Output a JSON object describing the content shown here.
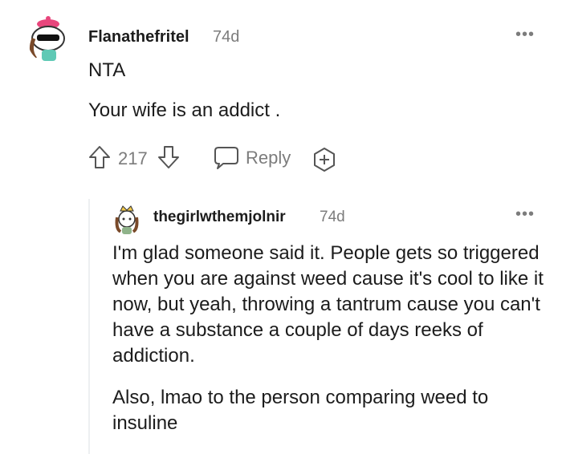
{
  "comment": {
    "username": "Flanathefritel",
    "age": "74d",
    "paragraphs": [
      "NTA",
      "Your wife is an addict ."
    ],
    "votes": "217",
    "reply_label": "Reply",
    "avatar_icon": "snoo-avatar-pink-hat-icon",
    "more_icon": "more-options-icon",
    "upvote_icon": "upvote-arrow-icon",
    "downvote_icon": "downvote-arrow-icon",
    "reply_icon": "reply-bubble-icon",
    "award_icon": "award-plus-icon"
  },
  "reply": {
    "username": "thegirlwthemjolnir",
    "age": "74d",
    "paragraphs": [
      "I'm glad someone said it. People gets so triggered when you are against weed cause it's cool to like it now, but yeah, throwing a tantrum cause you can't have a substance a couple of days reeks of addiction.",
      "Also, lmao to the person comparing weed to insuline"
    ],
    "avatar_icon": "snoo-avatar-crown-icon",
    "more_icon": "more-options-icon"
  },
  "colors": {
    "text": "#1c1c1c",
    "meta": "#7c7c7c",
    "thread_line": "#edeff1",
    "avatar_hat": "#e8467c"
  }
}
